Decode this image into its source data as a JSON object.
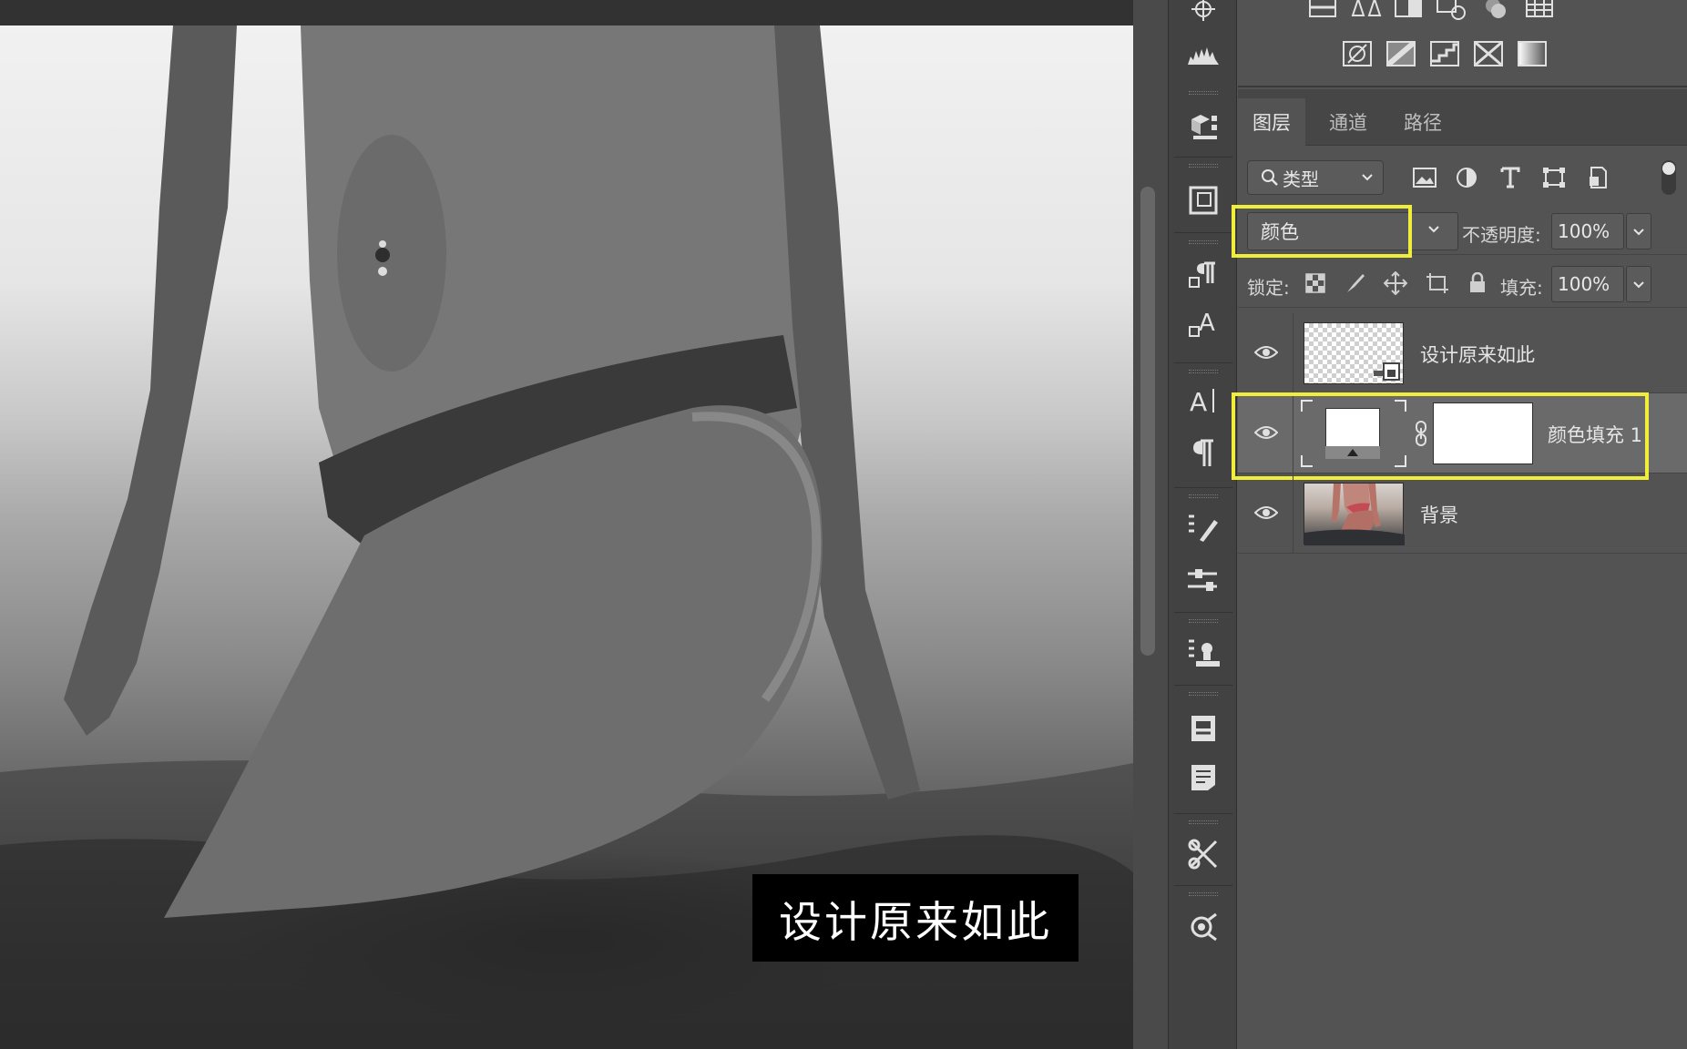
{
  "canvas": {
    "caption": "设计原来如此",
    "photo_desc_icon": "photo-canvas"
  },
  "tool_strip": {
    "tools": [
      "color-sampler-icon",
      "histogram-icon",
      "3d-icon",
      "navigator-icon",
      "paragraph-style-icon",
      "character-style-icon",
      "character-icon",
      "paragraph-icon",
      "brush-settings-icon",
      "properties-icon",
      "clone-source-icon",
      "notes-icon",
      "comments-icon",
      "tool-presets-icon",
      "paths-icon"
    ]
  },
  "adjustments": {
    "row1": [
      "brightness-contrast-icon",
      "levels-icon",
      "curves-icon",
      "exposure-icon",
      "vibrance-icon",
      "hue-saturation-icon",
      "color-lookup-icon"
    ],
    "row2": [
      "invert-icon",
      "posterize-icon",
      "threshold-icon",
      "selective-color-icon",
      "gradient-map-icon"
    ]
  },
  "panel": {
    "tabs": [
      {
        "label": "图层",
        "active": true
      },
      {
        "label": "通道",
        "active": false
      },
      {
        "label": "路径",
        "active": false
      }
    ],
    "filter": {
      "label": "类型"
    },
    "blend_mode": "颜色",
    "opacity_label": "不透明度:",
    "opacity_value": "100%",
    "lock_label": "锁定:",
    "fill_label": "填充:",
    "fill_value": "100%"
  },
  "layers": [
    {
      "name": "设计原来如此",
      "visible": true,
      "type": "smart-object"
    },
    {
      "name": "颜色填充 1",
      "visible": true,
      "type": "color-fill",
      "selected": true
    },
    {
      "name": "背景",
      "visible": true,
      "type": "image"
    }
  ],
  "colors": {
    "highlight": "#f1ee3b",
    "panel_bg": "#535353",
    "selected_row": "#6a6a6a"
  }
}
